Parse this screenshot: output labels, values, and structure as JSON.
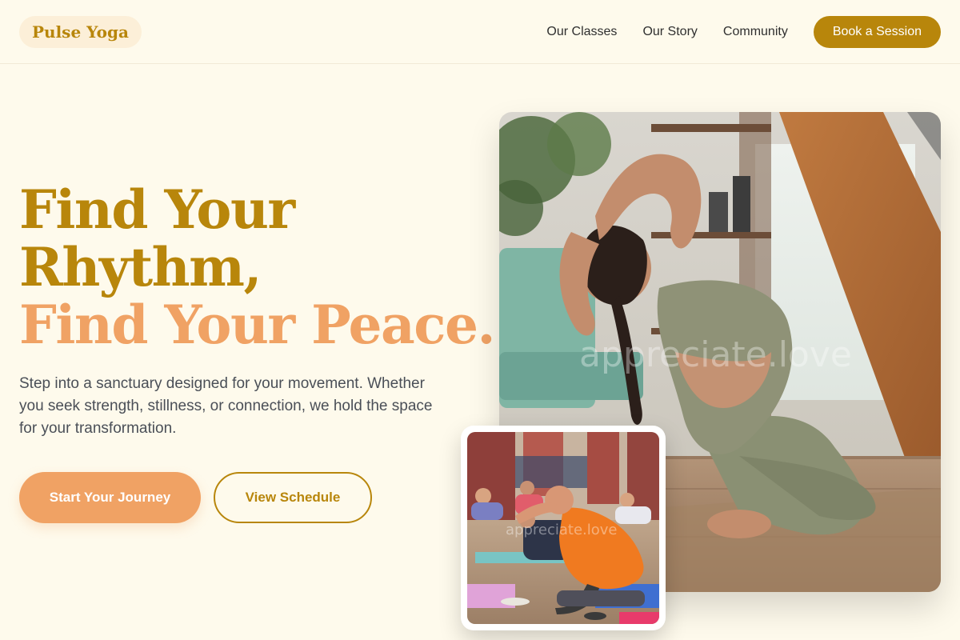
{
  "brand": {
    "name": "Pulse Yoga"
  },
  "nav": {
    "links": [
      "Our Classes",
      "Our Story",
      "Community"
    ],
    "cta_label": "Book a Session"
  },
  "hero": {
    "title_line1": "Find Your",
    "title_line2": "Rhythm,",
    "title_line3": "Find Your Peace.",
    "description": "Step into a sanctuary designed for your movement. Whether you seek strength, stillness, or connection, we hold the space for your transformation.",
    "primary_cta": "Start Your Journey",
    "secondary_cta": "View Schedule"
  },
  "images": {
    "main_watermark": "appreciate.love",
    "thumb_watermark": "appreciate.love"
  },
  "colors": {
    "background": "#fefaec",
    "brand_gold": "#b8860b",
    "accent_peach": "#f0a264",
    "text_muted": "#4a4f57"
  }
}
